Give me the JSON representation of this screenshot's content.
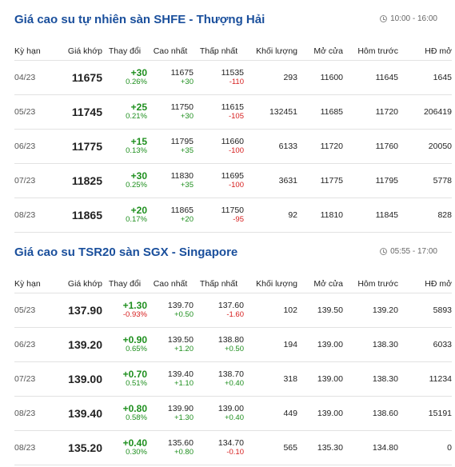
{
  "shfe": {
    "title": "Giá cao su tự nhiên sàn SHFE - Thượng Hải",
    "time": "10:00 - 16:00",
    "columns": [
      "Kỳ hạn",
      "Giá khớp",
      "Thay đổi",
      "Cao nhất",
      "Thấp nhất",
      "Khối lượng",
      "Mở cửa",
      "Hôm trước",
      "HĐ mở"
    ],
    "rows": [
      {
        "term": "04/23",
        "price": "11675",
        "chg": "+30",
        "chg_pct": "0.26%",
        "chg_dir": "up",
        "high": "11675",
        "high_d": "+30",
        "high_dir": "up",
        "low": "11535",
        "low_d": "-110",
        "low_dir": "down",
        "volume": "293",
        "open": "11600",
        "prev": "11645",
        "oi": "1645"
      },
      {
        "term": "05/23",
        "price": "11745",
        "chg": "+25",
        "chg_pct": "0.21%",
        "chg_dir": "up",
        "high": "11750",
        "high_d": "+30",
        "high_dir": "up",
        "low": "11615",
        "low_d": "-105",
        "low_dir": "down",
        "volume": "132451",
        "open": "11685",
        "prev": "11720",
        "oi": "206419"
      },
      {
        "term": "06/23",
        "price": "11775",
        "chg": "+15",
        "chg_pct": "0.13%",
        "chg_dir": "up",
        "high": "11795",
        "high_d": "+35",
        "high_dir": "up",
        "low": "11660",
        "low_d": "-100",
        "low_dir": "down",
        "volume": "6133",
        "open": "11720",
        "prev": "11760",
        "oi": "20050"
      },
      {
        "term": "07/23",
        "price": "11825",
        "chg": "+30",
        "chg_pct": "0.25%",
        "chg_dir": "up",
        "high": "11830",
        "high_d": "+35",
        "high_dir": "up",
        "low": "11695",
        "low_d": "-100",
        "low_dir": "down",
        "volume": "3631",
        "open": "11775",
        "prev": "11795",
        "oi": "5778"
      },
      {
        "term": "08/23",
        "price": "11865",
        "chg": "+20",
        "chg_pct": "0.17%",
        "chg_dir": "up",
        "high": "11865",
        "high_d": "+20",
        "high_dir": "up",
        "low": "11750",
        "low_d": "-95",
        "low_dir": "down",
        "volume": "92",
        "open": "11810",
        "prev": "11845",
        "oi": "828"
      }
    ]
  },
  "sgx": {
    "title": "Giá cao su TSR20 sàn SGX - Singapore",
    "time": "05:55 - 17:00",
    "columns": [
      "Kỳ hạn",
      "Giá khớp",
      "Thay đổi",
      "Cao nhất",
      "Thấp nhất",
      "Khối lượng",
      "Mở cửa",
      "Hôm trước",
      "HĐ mở"
    ],
    "rows": [
      {
        "term": "05/23",
        "price": "137.90",
        "chg": "+1.30",
        "chg_pct": "-0.93%",
        "chg_dir": "up",
        "pct_dir": "down",
        "high": "139.70",
        "high_d": "+0.50",
        "high_dir": "up",
        "low": "137.60",
        "low_d": "-1.60",
        "low_dir": "down",
        "volume": "102",
        "open": "139.50",
        "prev": "139.20",
        "oi": "5893"
      },
      {
        "term": "06/23",
        "price": "139.20",
        "chg": "+0.90",
        "chg_pct": "0.65%",
        "chg_dir": "up",
        "pct_dir": "up",
        "high": "139.50",
        "high_d": "+1.20",
        "high_dir": "up",
        "low": "138.80",
        "low_d": "+0.50",
        "low_dir": "up",
        "volume": "194",
        "open": "139.00",
        "prev": "138.30",
        "oi": "6033"
      },
      {
        "term": "07/23",
        "price": "139.00",
        "chg": "+0.70",
        "chg_pct": "0.51%",
        "chg_dir": "up",
        "pct_dir": "up",
        "high": "139.40",
        "high_d": "+1.10",
        "high_dir": "up",
        "low": "138.70",
        "low_d": "+0.40",
        "low_dir": "up",
        "volume": "318",
        "open": "139.00",
        "prev": "138.30",
        "oi": "11234"
      },
      {
        "term": "08/23",
        "price": "139.40",
        "chg": "+0.80",
        "chg_pct": "0.58%",
        "chg_dir": "up",
        "pct_dir": "up",
        "high": "139.90",
        "high_d": "+1.30",
        "high_dir": "up",
        "low": "139.00",
        "low_d": "+0.40",
        "low_dir": "up",
        "volume": "449",
        "open": "139.00",
        "prev": "138.60",
        "oi": "15191"
      },
      {
        "term": "08/23",
        "price": "135.20",
        "chg": "+0.40",
        "chg_pct": "0.30%",
        "chg_dir": "up",
        "pct_dir": "up",
        "high": "135.60",
        "high_d": "+0.80",
        "high_dir": "up",
        "low": "134.70",
        "low_d": "-0.10",
        "low_dir": "down",
        "volume": "565",
        "open": "135.30",
        "prev": "134.80",
        "oi": "0"
      }
    ]
  },
  "colors": {
    "title": "#1a4f9c",
    "up": "#1e8f1e",
    "down": "#d61c1c"
  },
  "icons": {
    "time": "clock-icon"
  }
}
